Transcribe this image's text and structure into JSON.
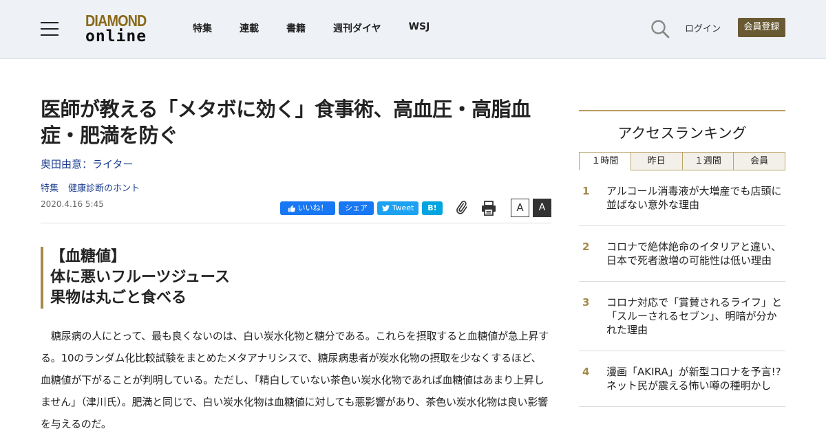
{
  "header": {
    "logo_top": "DIAMOND",
    "logo_bottom": "online",
    "nav": [
      "特集",
      "連載",
      "書籍",
      "週刊ダイヤ",
      "WSJ"
    ],
    "login_label": "ログイン",
    "register_label": "会員登録",
    "brand_color": "#6a5a33"
  },
  "article": {
    "title": "医師が教える「メタボに効く」食事術、高血圧・高脂血症・肥満を防ぐ",
    "author": "奥田由意：ライター",
    "tags": [
      "特集",
      "健康診断のホント"
    ],
    "date": "2020.4.16 5:45",
    "share": {
      "like": "いいね！",
      "share": "シェア",
      "tweet": "Tweet",
      "hatena": "B!",
      "font_small": "A",
      "font_large": "A"
    },
    "subheading": [
      "【血糖値】",
      "体に悪いフルーツジュース",
      "果物は丸ごと食べる"
    ],
    "body": "糖尿病の人にとって、最も良くないのは、白い炭水化物と糖分である。これらを摂取すると血糖値が急上昇する。10のランダム化比較試験をまとめたメタアナリシスで、糖尿病患者が炭水化物の摂取を少なくするほど、血糖値が下がることが判明している。ただし、「精白していない茶色い炭水化物であれば血糖値はあまり上昇しません」（津川氏）。肥満と同じで、白い炭水化物は血糖値に対しても悪影響があり、茶色い炭水化物は良い影響を与えるのだ。"
  },
  "sidebar": {
    "ranking_title": "アクセスランキング",
    "tabs": [
      "１時間",
      "昨日",
      "１週間",
      "会員"
    ],
    "active_tab": "１時間",
    "items": [
      {
        "rank": "1",
        "title": "アルコール消毒液が大増産でも店頭に並ばない意外な理由"
      },
      {
        "rank": "2",
        "title": "コロナで絶体絶命のイタリアと違い、日本で死者激増の可能性は低い理由"
      },
      {
        "rank": "3",
        "title": "コロナ対応で「賞賛されるライフ」と「スルーされるセブン」、明暗が分かれた理由"
      },
      {
        "rank": "4",
        "title": "漫画「AKIRA」が新型コロナを予言!?ネット民が震える怖い噂の種明かし"
      }
    ]
  }
}
